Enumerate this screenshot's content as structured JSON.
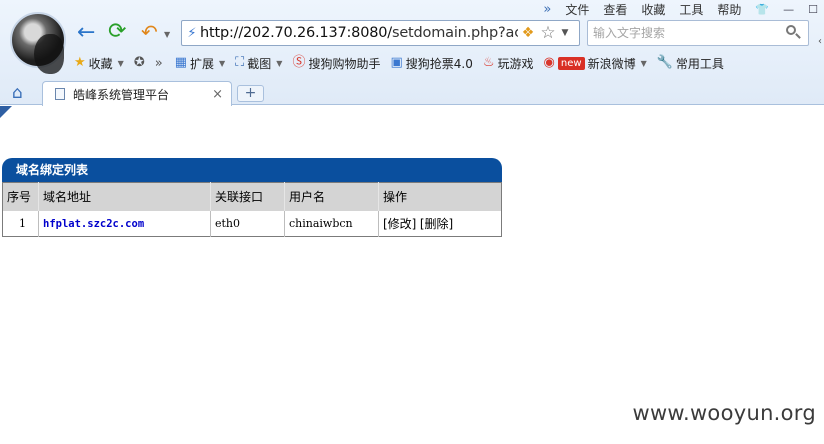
{
  "menubar": {
    "more": "»",
    "items": [
      "文件",
      "查看",
      "收藏",
      "工具",
      "帮助"
    ]
  },
  "address": {
    "url_host": "http://202.70.26.137:8080/",
    "url_path": "setdomain.php?actio"
  },
  "search": {
    "placeholder": "输入文字搜索"
  },
  "favorites": {
    "collect": "收藏",
    "more": "»",
    "extend": "扩展",
    "screenshot": "截图",
    "shopping": "搜狗购物助手",
    "tickets": "搜狗抢票4.0",
    "games": "玩游戏",
    "weibo_badge": "new",
    "weibo": "新浪微博",
    "tools": "常用工具"
  },
  "tab": {
    "title": "皓峰系统管理平台",
    "close": "×",
    "new": "+"
  },
  "panel": {
    "title": "域名绑定列表",
    "columns": [
      "序号",
      "域名地址",
      "关联接口",
      "用户名",
      "操作"
    ],
    "rows": [
      {
        "num": "1",
        "domain": "hfplat.szc2c.com",
        "iface": "eth0",
        "user": "chinaiwbcn",
        "edit": "[修改]",
        "delete": "[删除]"
      }
    ]
  },
  "watermark": "www.wooyun.org",
  "colors": {
    "panel_header": "#0a4f9e",
    "link": "#0000cc",
    "table_header": "#d4d4d4"
  }
}
